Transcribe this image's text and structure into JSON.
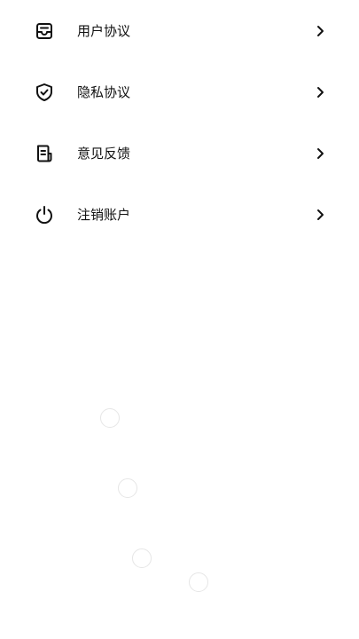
{
  "menu": {
    "items": [
      {
        "label": "用户协议",
        "icon": "inbox-icon"
      },
      {
        "label": "隐私协议",
        "icon": "shield-check-icon"
      },
      {
        "label": "意见反馈",
        "icon": "document-icon"
      },
      {
        "label": "注销账户",
        "icon": "power-icon"
      }
    ],
    "chevron_icon": "chevron-right-icon"
  },
  "colors": {
    "background": "#ffffff",
    "text": "#111111",
    "icon": "#111111",
    "loading_ring": "#e6e6e6"
  }
}
